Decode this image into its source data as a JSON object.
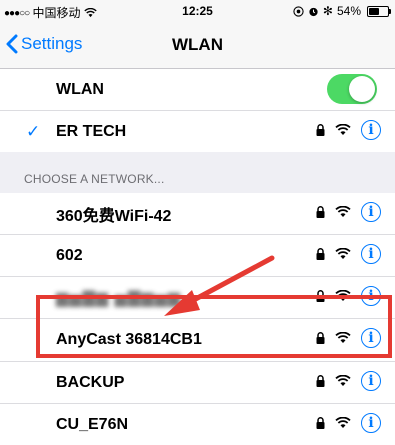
{
  "status_bar": {
    "carrier": "中国移动",
    "time": "12:25",
    "battery": "54%",
    "battery_level": 0.54
  },
  "nav": {
    "back_label": "Settings",
    "title": "WLAN"
  },
  "wlan_toggle": {
    "label": "WLAN",
    "on": true
  },
  "connected_network": {
    "name": "ER TECH"
  },
  "section_header": "CHOOSE A NETWORK...",
  "networks": [
    {
      "name": "360免费WiFi-42"
    },
    {
      "name": "602"
    },
    {
      "name": ""
    },
    {
      "name": "AnyCast 36814CB1"
    },
    {
      "name": "BACKUP"
    },
    {
      "name": "CU_E76N"
    }
  ],
  "colors": {
    "accent": "#007aff",
    "toggle_on": "#4cd964",
    "annotation": "#e53a32"
  }
}
